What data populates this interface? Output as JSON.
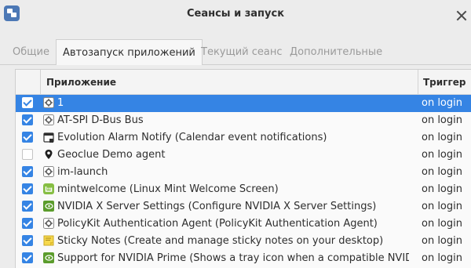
{
  "window": {
    "title": "Сеансы и запуск"
  },
  "tabs": [
    {
      "label": "Общие"
    },
    {
      "label": "Автозапуск приложений"
    },
    {
      "label": "Текущий сеанс"
    },
    {
      "label": "Дополнительные"
    }
  ],
  "table": {
    "columns": [
      "Приложение",
      "Триггер"
    ],
    "rows": [
      {
        "name": "1",
        "trigger": "on login",
        "checked": true,
        "selected": true,
        "icon": "gear-icon"
      },
      {
        "name": "AT-SPI D-Bus Bus",
        "trigger": "on login",
        "checked": true,
        "selected": false,
        "icon": "gear-icon"
      },
      {
        "name": "Evolution Alarm Notify (Calendar event notifications)",
        "trigger": "on login",
        "checked": true,
        "selected": false,
        "icon": "calendar-alarm-icon"
      },
      {
        "name": "Geoclue Demo agent",
        "trigger": "on login",
        "checked": false,
        "selected": false,
        "icon": "location-pin-icon"
      },
      {
        "name": "im-launch",
        "trigger": "on login",
        "checked": true,
        "selected": false,
        "icon": "gear-icon"
      },
      {
        "name": "mintwelcome (Linux Mint Welcome Screen)",
        "trigger": "on login",
        "checked": true,
        "selected": false,
        "icon": "mint-logo-icon"
      },
      {
        "name": "NVIDIA X Server Settings (Configure NVIDIA X Server Settings)",
        "trigger": "on login",
        "checked": true,
        "selected": false,
        "icon": "nvidia-icon"
      },
      {
        "name": "PolicyKit Authentication Agent (PolicyKit Authentication Agent)",
        "trigger": "on login",
        "checked": true,
        "selected": false,
        "icon": "gear-icon"
      },
      {
        "name": "Sticky Notes (Create and manage sticky notes on your desktop)",
        "trigger": "on login",
        "checked": true,
        "selected": false,
        "icon": "sticky-note-icon"
      },
      {
        "name": "Support for NVIDIA Prime (Shows a tray icon when a compatible NVIDIA …",
        "trigger": "on login",
        "checked": true,
        "selected": false,
        "icon": "nvidia-icon"
      }
    ]
  }
}
